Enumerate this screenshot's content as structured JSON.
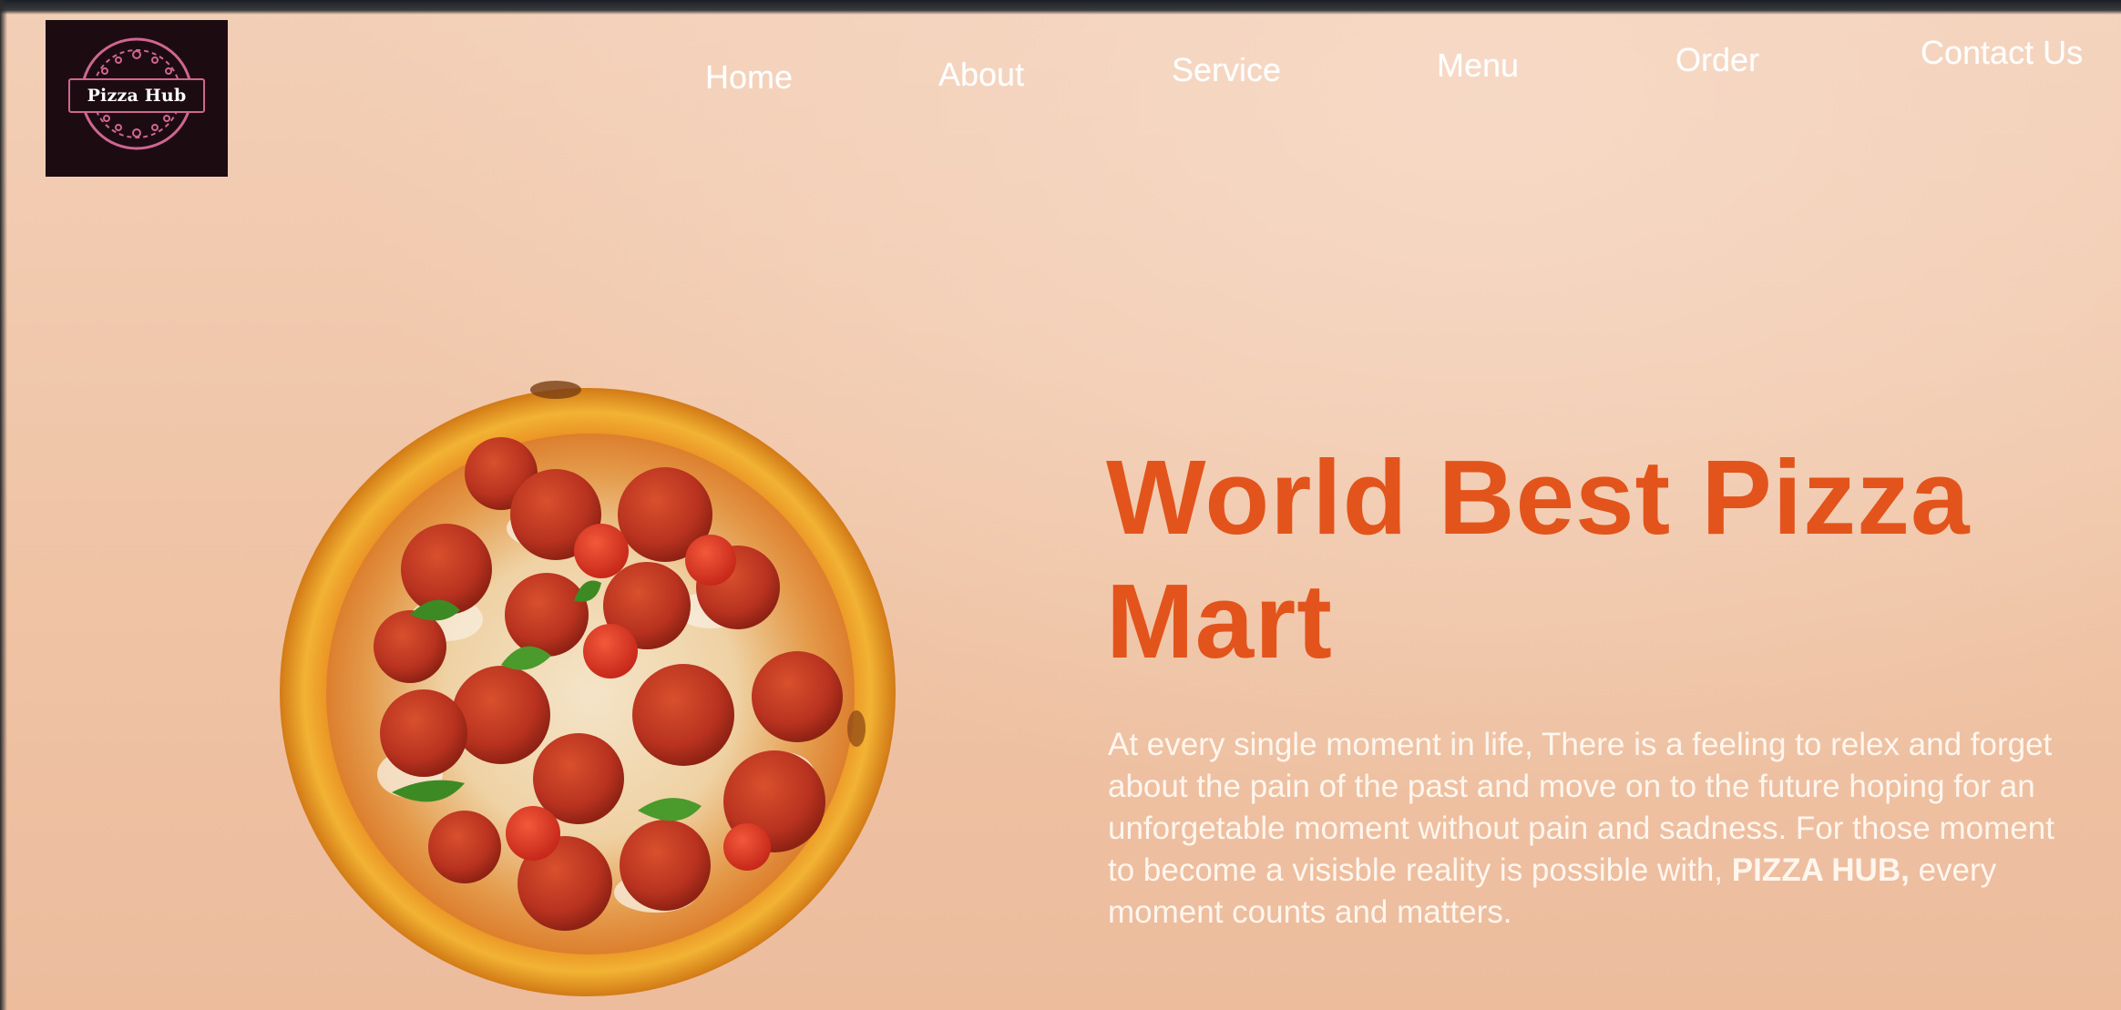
{
  "brand": {
    "logo_text": "Pizza Hub"
  },
  "nav": {
    "items": [
      {
        "label": "Home"
      },
      {
        "label": "About"
      },
      {
        "label": "Service"
      },
      {
        "label": "Menu"
      },
      {
        "label": "Order"
      },
      {
        "label": "Contact Us"
      }
    ]
  },
  "hero": {
    "title": "World Best Pizza Mart",
    "body_before": "At every single moment in life, There is a feeling to relex and forget about the pain of the past and move on to the future hoping for an unforgetable moment without pain and sadness. For those moment to become a visisble reality is possible with,",
    "body_highlight": "PIZZA HUB,",
    "body_after": "every moment counts and matters.",
    "image_icon": "pepperoni-pizza-image"
  },
  "colors": {
    "background": "#f1c9ac",
    "title": "#e2541b",
    "body_text": "#fff6ee",
    "nav_text": "#ffffff",
    "logo_bg": "#1c0c12",
    "logo_accent": "#d06690"
  }
}
